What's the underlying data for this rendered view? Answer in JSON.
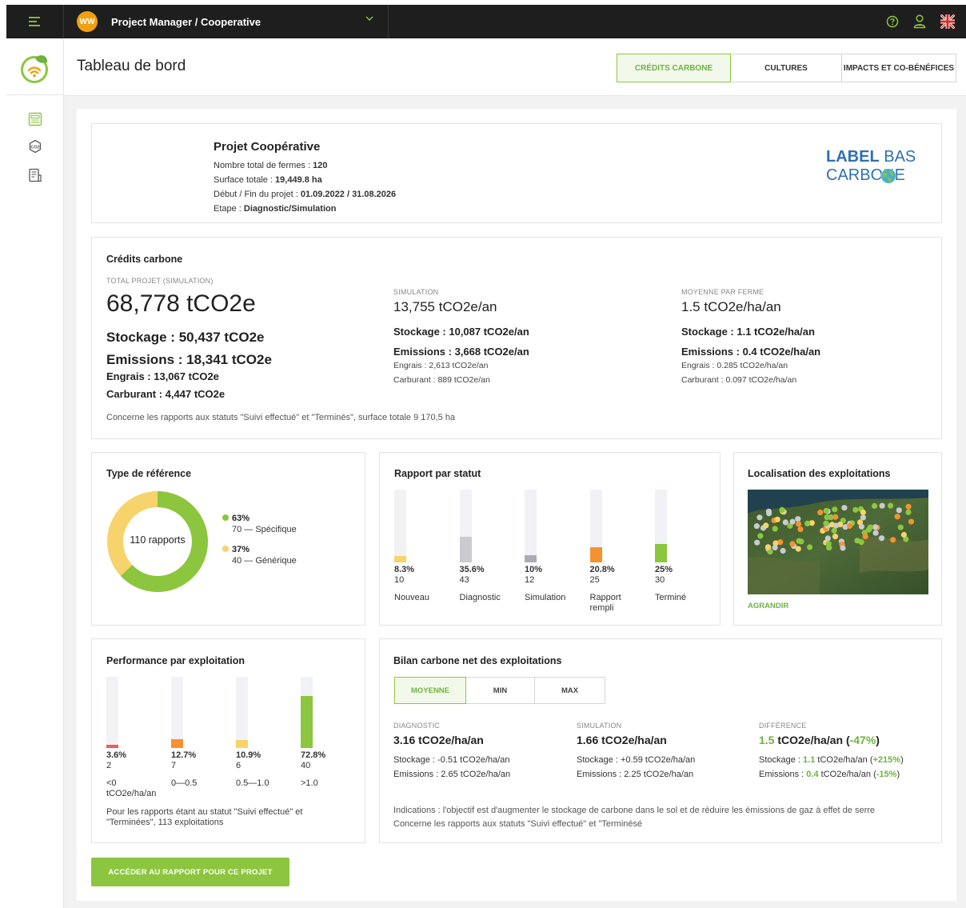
{
  "topbar": {
    "avatar_initials": "WW",
    "project_selector": "Project Manager / Cooperative"
  },
  "header": {
    "title": "Tableau de bord",
    "tabs": [
      {
        "label": "CRÉDITS CARBONE",
        "active": true
      },
      {
        "label": "CULTURES",
        "active": false
      },
      {
        "label": "IMPACTS ET CO-BÉNÉFICES",
        "active": false
      }
    ]
  },
  "project": {
    "name": "Projet Coopérative",
    "farms_label": "Nombre total de fermes : ",
    "farms_value": "120",
    "surface_label": "Surface totale : ",
    "surface_value": "19,449.8 ha",
    "dates_label": "Début / Fin du projet : ",
    "dates_value": "01.09.2022 / 31.08.2026",
    "stage_label": "Etape : ",
    "stage_value": "Diagnostic/Simulation",
    "label_logo_line1_a": "LABEL",
    "label_logo_line1_b": "BAS",
    "label_logo_line2": "CARBONE"
  },
  "credits": {
    "title": "Crédits carbone",
    "total_label": "TOTAL PROJET (SIMULATION)",
    "total_value": "68,778 tCO2e",
    "total_stockage": "Stockage : 50,437 tCO2e",
    "total_emissions": "Emissions : 18,341 tCO2e",
    "total_engrais": "Engrais : 13,067 tCO2e",
    "total_carburant": "Carburant : 4,447 tCO2e",
    "sim_label": "SIMULATION",
    "sim_value": "13,755 tCO2e/an",
    "sim_stockage": "Stockage : 10,087 tCO2e/an",
    "sim_emissions": "Emissions : 3,668 tCO2e/an",
    "sim_engrais": "Engrais : 2,613 tCO2e/an",
    "sim_carburant": "Carburant : 889 tCO2e/an",
    "avg_label": "MOYENNE PAR FERME",
    "avg_value": "1.5 tCO2e/ha/an",
    "avg_stockage": "Stockage : 1.1 tCO2e/ha/an",
    "avg_emissions": "Emissions : 0.4 tCO2e/ha/an",
    "avg_engrais": "Engrais : 0.285 tCO2e/ha/an",
    "avg_carburant": "Carburant : 0.097 tCO2e/ha/an",
    "note": "Concerne les rapports aux statuts \"Suivi effectué\" et \"Terminés\", surface totale 9 170,5 ha"
  },
  "reference": {
    "title": "Type de référence",
    "center_label": "110 rapports",
    "items": [
      {
        "pct": "63%",
        "desc": "70 — Spécifique",
        "fraction": 0.63,
        "color": "#8cc63f"
      },
      {
        "pct": "37%",
        "desc": "40 — Générique",
        "fraction": 0.37,
        "color": "#f7d36b"
      }
    ]
  },
  "status": {
    "title": "Rapport par statut",
    "bars": [
      {
        "pct": "8.3%",
        "count": "10",
        "label": "Nouveau",
        "fraction": 0.083,
        "color": "#f7d36b"
      },
      {
        "pct": "35.6%",
        "count": "43",
        "label": "Diagnostic",
        "fraction": 0.356,
        "color": "#c9cbd0"
      },
      {
        "pct": "10%",
        "count": "12",
        "label": "Simulation",
        "fraction": 0.1,
        "color": "#a8acb4"
      },
      {
        "pct": "20.8%",
        "count": "25",
        "label": "Rapport rempli",
        "fraction": 0.208,
        "color": "#f5922f"
      },
      {
        "pct": "25%",
        "count": "30",
        "label": "Terminé",
        "fraction": 0.25,
        "color": "#8cc63f"
      }
    ]
  },
  "map": {
    "title": "Localisation des exploitations",
    "link": "AGRANDIR"
  },
  "performance": {
    "title": "Performance par exploitation",
    "bars": [
      {
        "pct": "3.6%",
        "count": "2",
        "label": "<0",
        "label2": "tCO2e/ha/an",
        "fraction": 0.036,
        "color": "#f05a5a"
      },
      {
        "pct": "12.7%",
        "count": "7",
        "label": "0—0.5",
        "label2": "",
        "fraction": 0.127,
        "color": "#f5922f"
      },
      {
        "pct": "10.9%",
        "count": "6",
        "label": "0.5—1.0",
        "label2": "",
        "fraction": 0.109,
        "color": "#f7d36b"
      },
      {
        "pct": "72.8%",
        "count": "40",
        "label": ">1.0",
        "label2": "",
        "fraction": 0.728,
        "color": "#8cc63f"
      }
    ],
    "note": "Pour les rapports étant au statut \"Suivi effectué\" et \"Terminées\", 113 exploitations"
  },
  "bilan": {
    "title": "Bilan carbone net des exploitations",
    "segments": [
      {
        "label": "MOYENNE",
        "active": true
      },
      {
        "label": "MIN",
        "active": false
      },
      {
        "label": "MAX",
        "active": false
      }
    ],
    "diag_label": "DIAGNOSTIC",
    "diag_value": "3.16 tCO2e/ha/an",
    "diag_stockage": "Stockage : -0.51 tCO2e/ha/an",
    "diag_emissions": "Emissions : 2.65 tCO2e/ha/an",
    "sim_label": "SIMULATION",
    "sim_value": "1.66 tCO2e/ha/an",
    "sim_stockage": "Stockage : +0.59 tCO2e/ha/an",
    "sim_emissions": "Emissions : 2.25 tCO2e/ha/an",
    "diff_label": "DIFFÉRENCE",
    "diff_value_num": "1.5",
    "diff_value_unit": " tCO2e/ha/an (",
    "diff_value_pct": "-47%",
    "diff_value_close": ")",
    "diff_stockage_pre": "Stockage : ",
    "diff_stockage_num": "1.1",
    "diff_stockage_mid": " tCO2e/ha/an (",
    "diff_stockage_pct": "+215%",
    "diff_stockage_close": ")",
    "diff_emissions_pre": "Emissions : ",
    "diff_emissions_num": "0.4",
    "diff_emissions_mid": " tCO2e/ha/an (",
    "diff_emissions_pct": "-15%",
    "diff_emissions_close": ")",
    "indication": "Indications : l'objectif est d'augmenter le stockage de carbone dans le sol et de réduire les émissions de gaz à effet de serre",
    "note": "Concerne les rapports aux statuts \"Suivi effectué\" et \"Terminésé"
  },
  "cta": {
    "label": "ACCÉDER AU RAPPORT POUR CE PROJET"
  }
}
